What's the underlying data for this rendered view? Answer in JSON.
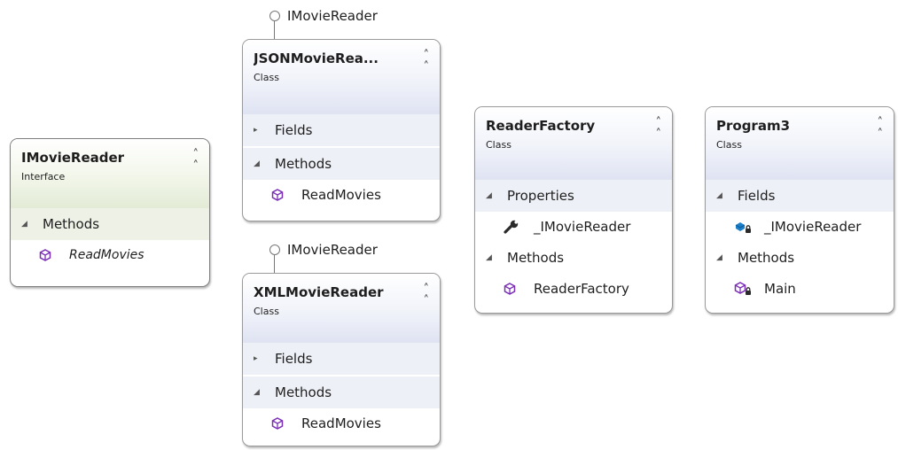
{
  "lollipops": [
    {
      "label": "IMovieReader"
    },
    {
      "label": "IMovieReader"
    }
  ],
  "shapes": {
    "imoviereader": {
      "name": "IMovieReader",
      "kind": "Interface",
      "methods_label": "Methods",
      "methods": [
        {
          "name": "ReadMovies"
        }
      ]
    },
    "json": {
      "name": "JSONMovieRea...",
      "kind": "Class",
      "fields_label": "Fields",
      "methods_label": "Methods",
      "methods": [
        {
          "name": "ReadMovies"
        }
      ]
    },
    "xml": {
      "name": "XMLMovieReader",
      "kind": "Class",
      "fields_label": "Fields",
      "methods_label": "Methods",
      "methods": [
        {
          "name": "ReadMovies"
        }
      ]
    },
    "readerfactory": {
      "name": "ReaderFactory",
      "kind": "Class",
      "properties_label": "Properties",
      "properties": [
        {
          "name": "_IMovieReader"
        }
      ],
      "methods_label": "Methods",
      "methods": [
        {
          "name": "ReaderFactory"
        }
      ]
    },
    "program3": {
      "name": "Program3",
      "kind": "Class",
      "fields_label": "Fields",
      "fields": [
        {
          "name": "_IMovieReader"
        }
      ],
      "methods_label": "Methods",
      "methods": [
        {
          "name": "Main"
        }
      ]
    }
  },
  "colors": {
    "class_header": "#dfe3f2",
    "interface_header": "#e3ebd6",
    "method_icon": "#7a2fb5",
    "field_icon": "#1c7fc8"
  },
  "icons": {
    "method": "cube-icon",
    "property": "wrench-icon",
    "field": "field-icon",
    "private": "lock-icon",
    "collapse": "double-chevron-up-icon",
    "expanded": "triangle-down-icon",
    "collapsed": "triangle-right-icon"
  }
}
